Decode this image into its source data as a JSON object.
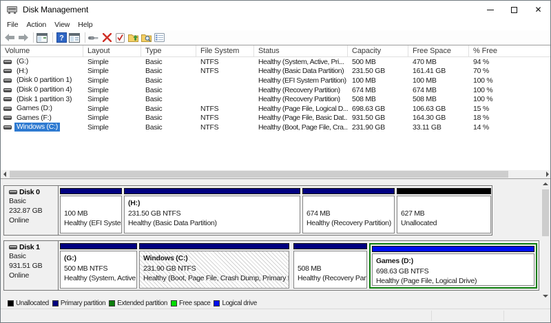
{
  "window": {
    "title": "Disk Management"
  },
  "menu": {
    "file": "File",
    "action": "Action",
    "view": "View",
    "help": "Help"
  },
  "toolbar": {
    "icons": [
      "back-arrow",
      "forward-arrow",
      "console-window",
      "help",
      "console-window-2",
      "disk-tool",
      "delete",
      "check-document",
      "folder-export",
      "folder-find",
      "properties-list"
    ]
  },
  "table": {
    "columns": [
      "Volume",
      "Layout",
      "Type",
      "File System",
      "Status",
      "Capacity",
      "Free Space",
      "% Free"
    ],
    "rows": [
      {
        "volume": "(G:)",
        "layout": "Simple",
        "type": "Basic",
        "fs": "NTFS",
        "status": "Healthy (System, Active, Pri...",
        "capacity": "500 MB",
        "free": "470 MB",
        "pct": "94 %"
      },
      {
        "volume": "(H:)",
        "layout": "Simple",
        "type": "Basic",
        "fs": "NTFS",
        "status": "Healthy (Basic Data Partition)",
        "capacity": "231.50 GB",
        "free": "161.41 GB",
        "pct": "70 %"
      },
      {
        "volume": "(Disk 0 partition 1)",
        "layout": "Simple",
        "type": "Basic",
        "fs": "",
        "status": "Healthy (EFI System Partition)",
        "capacity": "100 MB",
        "free": "100 MB",
        "pct": "100 %"
      },
      {
        "volume": "(Disk 0 partition 4)",
        "layout": "Simple",
        "type": "Basic",
        "fs": "",
        "status": "Healthy (Recovery Partition)",
        "capacity": "674 MB",
        "free": "674 MB",
        "pct": "100 %"
      },
      {
        "volume": "(Disk 1 partition 3)",
        "layout": "Simple",
        "type": "Basic",
        "fs": "",
        "status": "Healthy (Recovery Partition)",
        "capacity": "508 MB",
        "free": "508 MB",
        "pct": "100 %"
      },
      {
        "volume": "Games (D:)",
        "layout": "Simple",
        "type": "Basic",
        "fs": "NTFS",
        "status": "Healthy (Page File, Logical D...",
        "capacity": "698.63 GB",
        "free": "106.63 GB",
        "pct": "15 %"
      },
      {
        "volume": "Games (F:)",
        "layout": "Simple",
        "type": "Basic",
        "fs": "NTFS",
        "status": "Healthy (Page File, Basic Dat...",
        "capacity": "931.50 GB",
        "free": "164.30 GB",
        "pct": "18 %"
      },
      {
        "volume": "Windows (C:)",
        "layout": "Simple",
        "type": "Basic",
        "fs": "NTFS",
        "status": "Healthy (Boot, Page File, Cra...",
        "capacity": "231.90 GB",
        "free": "33.11 GB",
        "pct": "14 %"
      }
    ],
    "selected_row": "Windows (C:)"
  },
  "disks": [
    {
      "name": "Disk 0",
      "type": "Basic",
      "size": "232.87 GB",
      "status": "Online",
      "partitions": [
        {
          "line1": "",
          "line2": "100 MB",
          "line3": "Healthy (EFI System",
          "kind": "primary"
        },
        {
          "line1": "(H:)",
          "line2": "231.50 GB NTFS",
          "line3": "Healthy (Basic Data Partition)",
          "kind": "primary"
        },
        {
          "line1": "",
          "line2": "674 MB",
          "line3": "Healthy (Recovery Partition)",
          "kind": "primary"
        },
        {
          "line1": "",
          "line2": "627 MB",
          "line3": "Unallocated",
          "kind": "unallocated"
        }
      ]
    },
    {
      "name": "Disk 1",
      "type": "Basic",
      "size": "931.51 GB",
      "status": "Online",
      "partitions": [
        {
          "line1": "(G:)",
          "line2": "500 MB NTFS",
          "line3": "Healthy (System, Active,",
          "kind": "primary"
        },
        {
          "line1": "Windows  (C:)",
          "line2": "231.90 GB NTFS",
          "line3": "Healthy (Boot, Page File, Crash Dump, Primary Parti",
          "kind": "primary",
          "hatched": true
        },
        {
          "line1": "",
          "line2": "508 MB",
          "line3": "Healthy (Recovery Partit",
          "kind": "primary"
        },
        {
          "line1": "Games  (D:)",
          "line2": "698.63 GB NTFS",
          "line3": "Healthy (Page File, Logical Drive)",
          "kind": "logical",
          "extended": true
        }
      ]
    }
  ],
  "legend": [
    {
      "label": "Unallocated",
      "color": "#000000"
    },
    {
      "label": "Primary partition",
      "color": "#000080"
    },
    {
      "label": "Extended partition",
      "color": "#0c7e0c"
    },
    {
      "label": "Free space",
      "color": "#00dd00"
    },
    {
      "label": "Logical drive",
      "color": "#0010ee"
    }
  ],
  "colors": {
    "primary_bar": "#000080",
    "unallocated_bar": "#000000",
    "logical_bar": "#0010ee",
    "selection": "#2e7ad1"
  }
}
